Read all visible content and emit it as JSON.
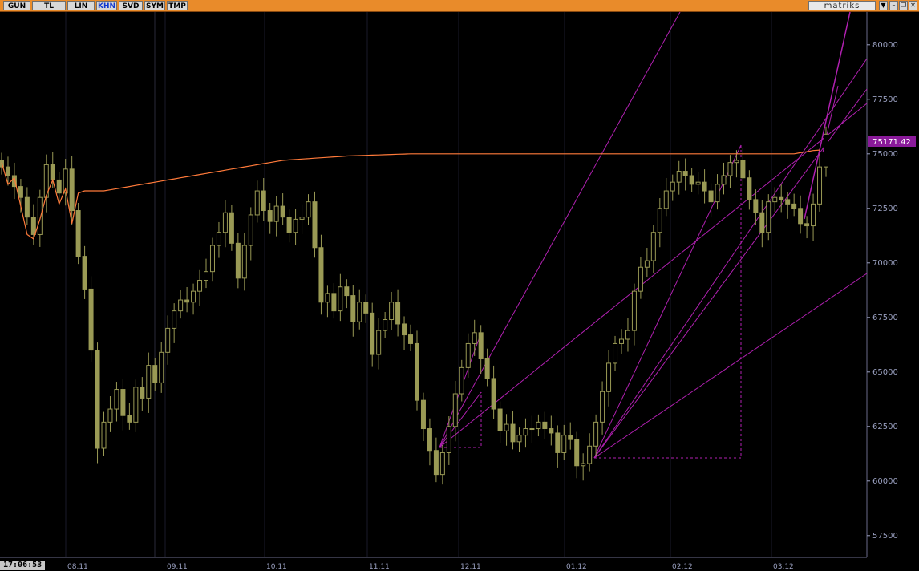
{
  "toolbar": {
    "buttons": [
      "GUN",
      "TL",
      "LIN",
      "KHN",
      "SVD",
      "SYM",
      "TMP"
    ],
    "active": "KHN",
    "brand": "matriks"
  },
  "status": {
    "time": "17:06:53"
  },
  "colors": {
    "candle": "#9a9a55",
    "average": "#ff7a3a",
    "fan": "#b020b0",
    "price_tag": "#8a1a9a",
    "axis": "#9aa0c0"
  },
  "chart_data": {
    "type": "candlestick",
    "ylim": [
      56500,
      81500
    ],
    "yticks": [
      57500,
      60000,
      62500,
      65000,
      67500,
      70000,
      72500,
      75000,
      77500,
      80000
    ],
    "xticks": [
      "08.11",
      "09.11",
      "10.11",
      "11.11",
      "12.11",
      "01.12",
      "02.12",
      "03.12"
    ],
    "last_price": "75171.42",
    "series": [
      {
        "name": "close",
        "values": [
          74400,
          74000,
          73500,
          73000,
          72100,
          71300,
          73000,
          74500,
          73800,
          73200,
          74300,
          72400,
          70300,
          68800,
          66000,
          61500,
          62700,
          63300,
          64200,
          63000,
          62700,
          64300,
          63800,
          65300,
          64500,
          65900,
          67000,
          67800,
          68300,
          68200,
          68700,
          69200,
          69600,
          70800,
          71400,
          72300,
          70900,
          69300,
          70800,
          72200,
          73300,
          72400,
          71900,
          72600,
          72100,
          71400,
          72000,
          72100,
          72800,
          70700,
          68200,
          68600,
          67800,
          68900,
          68500,
          67300,
          68200,
          67700,
          65800,
          66900,
          67400,
          68200,
          67200,
          66700,
          66300,
          63700,
          62400,
          61400,
          60300,
          61300,
          62500,
          64000,
          65200,
          66300,
          66800,
          65600,
          64700,
          63300,
          62300,
          62600,
          61800,
          62100,
          62400,
          62400,
          62700,
          62400,
          62200,
          61300,
          62100,
          61900,
          60700,
          60800,
          61600,
          62700,
          64100,
          65400,
          66300,
          66500,
          66900,
          68700,
          69800,
          70100,
          71400,
          72500,
          73300,
          73700,
          74200,
          74000,
          73600,
          73700,
          73300,
          72800,
          73600,
          74000,
          74600,
          74700,
          73900,
          72900,
          72300,
          71400,
          72800,
          73000,
          72900,
          72700,
          72500,
          71800,
          71700,
          72700,
          74400,
          75900
        ]
      },
      {
        "name": "average",
        "values": [
          74600,
          73600,
          73900,
          72600,
          71300,
          71100,
          72000,
          73100,
          73800,
          72700,
          73400,
          71800,
          73200,
          73300,
          73300,
          73300,
          73300,
          73350,
          73400,
          73450,
          73500,
          73550,
          73600,
          73650,
          73700,
          73750,
          73800,
          73850,
          73900,
          73950,
          74000,
          74050,
          74100,
          74150,
          74200,
          74250,
          74300,
          74350,
          74400,
          74450,
          74500,
          74550,
          74600,
          74650,
          74700,
          74720,
          74740,
          74760,
          74780,
          74800,
          74820,
          74840,
          74860,
          74880,
          74900,
          74910,
          74920,
          74930,
          74940,
          74950,
          74960,
          74970,
          74980,
          74990,
          75000,
          75000,
          75000,
          75000,
          75000,
          75000,
          75000,
          75000,
          75000,
          75000,
          75000,
          75000,
          75000,
          75000,
          75000,
          75000,
          75000,
          75000,
          75000,
          75000,
          75000,
          75000,
          75000,
          75000,
          75000,
          75000,
          75000,
          75000,
          75000,
          75000,
          75000,
          75000,
          75000,
          75000,
          75000,
          75000,
          75000,
          75000,
          75000,
          75000,
          75000,
          75000,
          75000,
          75000,
          75000,
          75000,
          75000,
          75000,
          75000,
          75000,
          75000,
          75000,
          75000,
          75000,
          75000,
          75000,
          75000,
          75000,
          75000,
          75000,
          75000,
          75050,
          75100,
          75150,
          75171
        ]
      }
    ]
  }
}
